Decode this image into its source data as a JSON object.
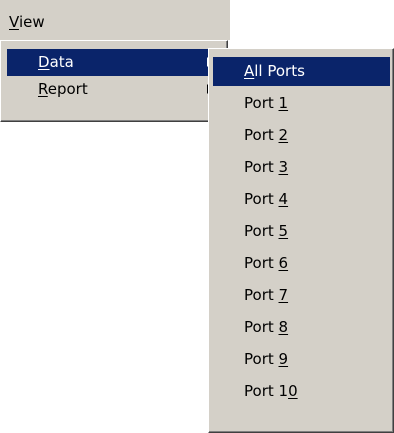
{
  "menubar": {
    "view": {
      "lead": "V",
      "rest": "iew"
    }
  },
  "view_menu": {
    "items": [
      {
        "lead": "D",
        "rest": "ata",
        "selected": true
      },
      {
        "lead": "R",
        "rest": "eport",
        "selected": false
      }
    ]
  },
  "data_submenu": {
    "items": [
      {
        "pre": "",
        "ul": "A",
        "post": "ll Ports",
        "selected": true
      },
      {
        "pre": "Port ",
        "ul": "1",
        "post": ""
      },
      {
        "pre": "Port ",
        "ul": "2",
        "post": ""
      },
      {
        "pre": "Port ",
        "ul": "3",
        "post": ""
      },
      {
        "pre": "Port ",
        "ul": "4",
        "post": ""
      },
      {
        "pre": "Port ",
        "ul": "5",
        "post": ""
      },
      {
        "pre": "Port ",
        "ul": "6",
        "post": ""
      },
      {
        "pre": "Port ",
        "ul": "7",
        "post": ""
      },
      {
        "pre": "Port ",
        "ul": "8",
        "post": ""
      },
      {
        "pre": "Port ",
        "ul": "9",
        "post": ""
      },
      {
        "pre": "Port 1",
        "ul": "0",
        "post": ""
      }
    ]
  },
  "colors": {
    "menu_face": "#d4d0c8",
    "highlight": "#0a246a",
    "highlight_text": "#ffffff"
  }
}
